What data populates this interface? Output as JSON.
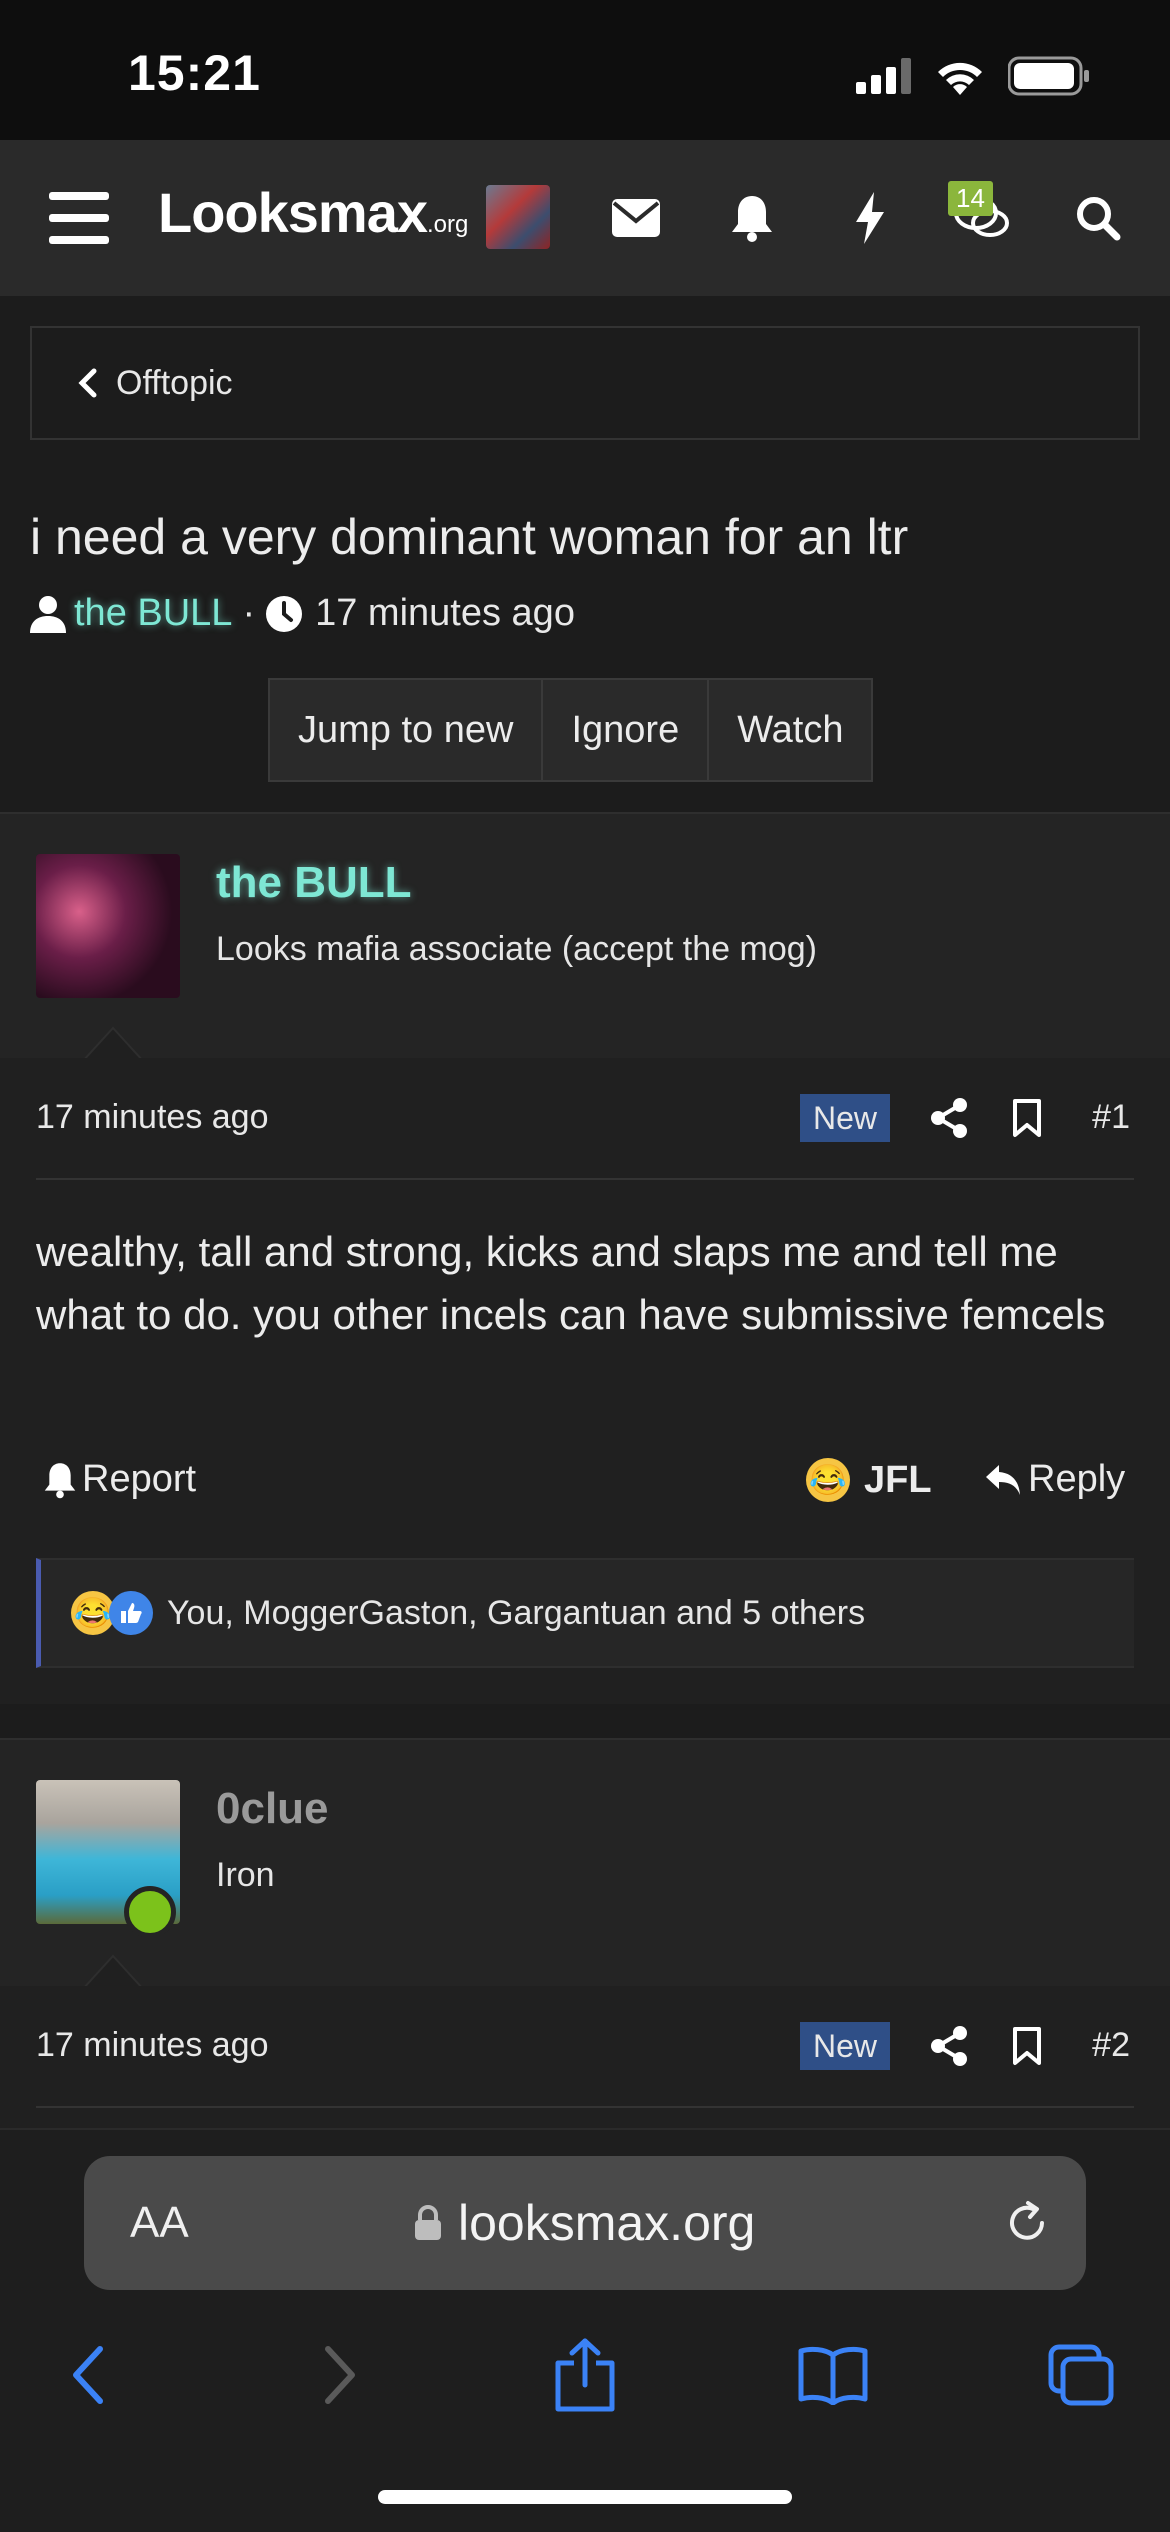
{
  "status_bar": {
    "time": "15:21"
  },
  "header": {
    "logo_main": "Looksmax",
    "logo_tld": ".org",
    "chat_badge_count": "14"
  },
  "breadcrumb": {
    "label": "Offtopic"
  },
  "thread": {
    "title": "i need a very dominant woman for an ltr",
    "author": "the BULL",
    "separator": "·",
    "time": "17 minutes ago",
    "buttons": {
      "jump_to_new": "Jump to new",
      "ignore": "Ignore",
      "watch": "Watch"
    }
  },
  "posts": [
    {
      "username": "the BULL",
      "user_title": "Looks mafia associate (accept the mog)",
      "time": "17 minutes ago",
      "new_badge": "New",
      "number": "#1",
      "text": "wealthy, tall and strong, kicks and slaps me and tell me what to do. you other incels can have submissive femcels",
      "report_label": "Report",
      "reaction_label": "JFL",
      "reply_label": "Reply",
      "reactions_text": "You, MoggerGaston, Gargantuan and 5 others"
    },
    {
      "username": "0clue",
      "user_title": "Iron",
      "time": "17 minutes ago",
      "new_badge": "New",
      "number": "#2"
    }
  ],
  "browser": {
    "aa_label": "AA",
    "url": "looksmax.org"
  },
  "colors": {
    "accent_green": "#7ee7d4",
    "link_blue": "#3b82f6",
    "new_badge": "#2f4f87",
    "reaction_border": "#4a5bb0",
    "online_dot": "#7cc21b",
    "chat_badge": "#8bb63c"
  }
}
